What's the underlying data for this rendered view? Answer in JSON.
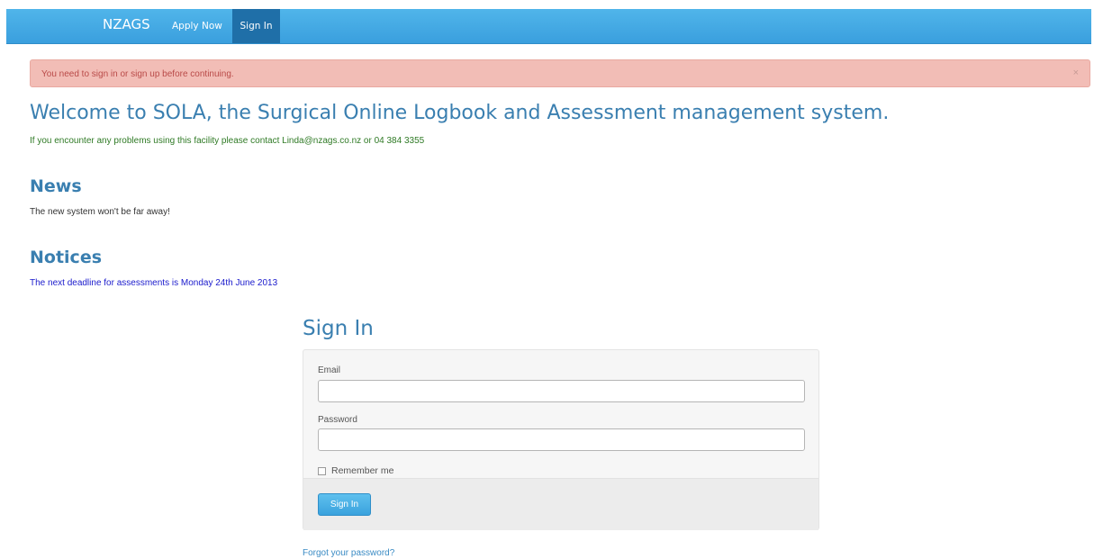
{
  "navbar": {
    "brand": "NZAGS",
    "items": [
      {
        "label": "Apply Now",
        "active": false
      },
      {
        "label": "Sign In",
        "active": true
      }
    ]
  },
  "alert": {
    "message": "You need to sign in or sign up before continuing.",
    "close_glyph": "×"
  },
  "main": {
    "welcome_title": "Welcome to SOLA, the Surgical Online Logbook and Assessment management system.",
    "contact_text": "If you encounter any problems using this facility please contact Linda@nzags.co.nz or 04 384 3355",
    "news_title": "News",
    "news_text": "The new system won't be far away!",
    "notices_title": "Notices",
    "notices_text": "The next deadline for assessments is Monday 24th June 2013"
  },
  "signin": {
    "title": "Sign In",
    "email_label": "Email",
    "email_value": "",
    "password_label": "Password",
    "password_value": "",
    "remember_label": "Remember me",
    "remember_checked": false,
    "submit_label": "Sign In",
    "forgot_link": "Forgot your password?"
  },
  "colors": {
    "navbar": "#3a9fde",
    "active_nav": "#1f6fa8",
    "alert_bg": "#f2bdb6",
    "alert_text": "#b94a48",
    "heading": "#3a7fb0",
    "contact_text": "#2f7a25",
    "notice_text": "#1a1acc"
  }
}
